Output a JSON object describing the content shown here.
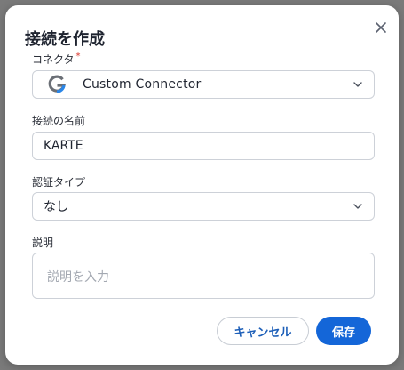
{
  "dialog": {
    "title": "接続を作成",
    "close_icon": "close-icon"
  },
  "connector": {
    "label": "コネクタ",
    "required_mark": "*",
    "selected": "Custom Connector",
    "logo_icon": "g-logo-icon"
  },
  "connection_name": {
    "label": "接続の名前",
    "value": "KARTE"
  },
  "auth_type": {
    "label": "認証タイプ",
    "selected": "なし"
  },
  "description": {
    "label": "説明",
    "placeholder": "説明を入力"
  },
  "buttons": {
    "cancel": "キャンセル",
    "save": "保存"
  },
  "colors": {
    "primary": "#1466d8",
    "logo_gray": "#6b6f76",
    "logo_blue": "#2a86e8"
  }
}
